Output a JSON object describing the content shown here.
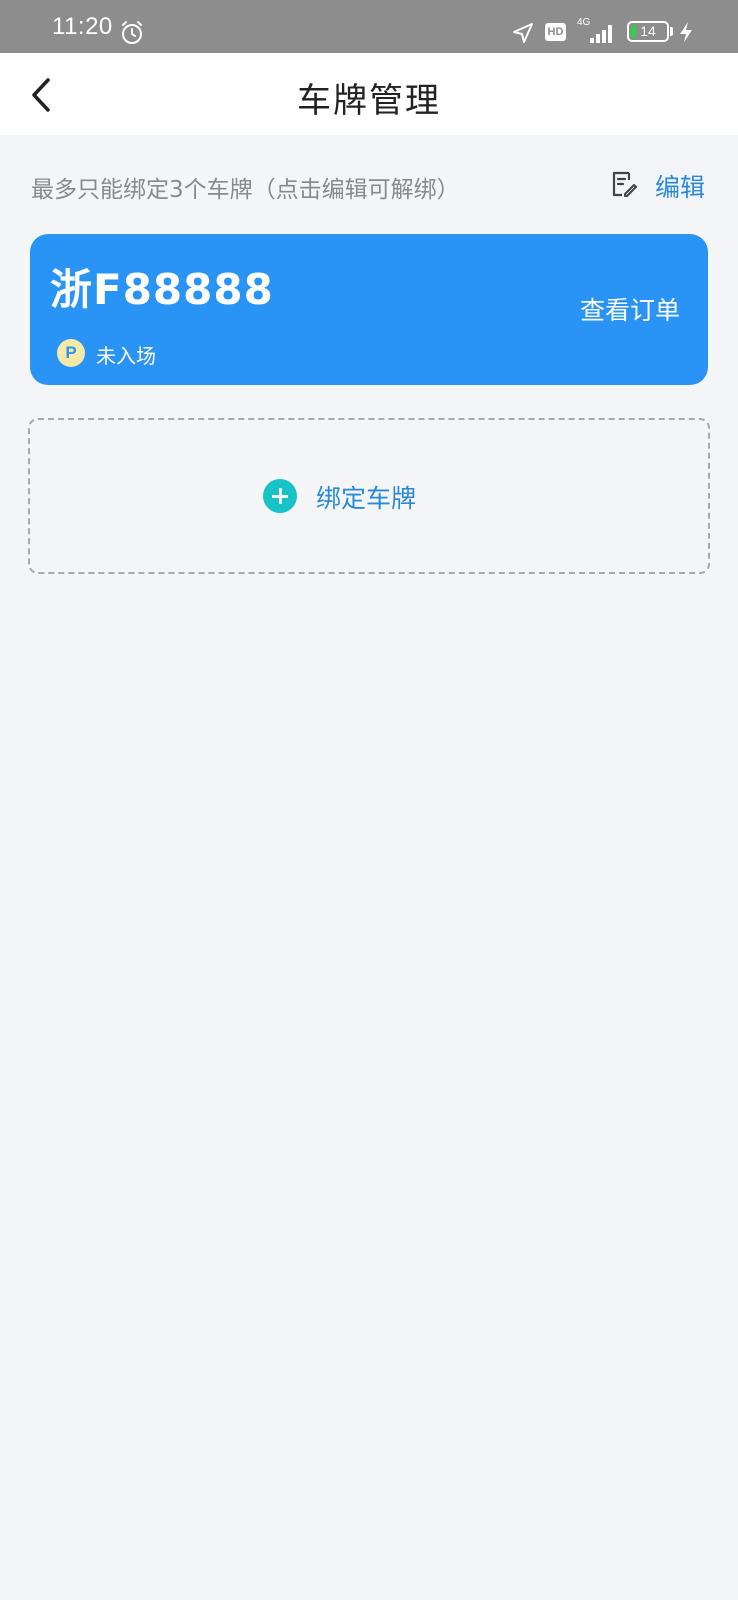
{
  "status_bar": {
    "time": "11:20",
    "alarm_icon": "alarm-clock-icon",
    "location_icon": "location-arrow-icon",
    "hd_label": "HD",
    "network_label": "4G",
    "signal_icon": "signal-bars-icon",
    "battery_level": "14",
    "charging_icon": "lightning-icon"
  },
  "header": {
    "back_icon": "chevron-left-icon",
    "title": "车牌管理"
  },
  "hint": {
    "text": "最多只能绑定3个车牌（点击编辑可解绑）",
    "edit_icon": "edit-document-icon",
    "edit_label": "编辑"
  },
  "plates": [
    {
      "number": "浙F88888",
      "status_icon": "parking-icon",
      "status_icon_text": "P",
      "status": "未入场",
      "action_label": "查看订单"
    }
  ],
  "bind": {
    "icon": "plus-circle-icon",
    "label": "绑定车牌"
  },
  "colors": {
    "card_blue": "#2a94f6",
    "accent_teal": "#17c3c9",
    "link_blue": "#2a8ad9",
    "background": "#f4f5f7"
  }
}
